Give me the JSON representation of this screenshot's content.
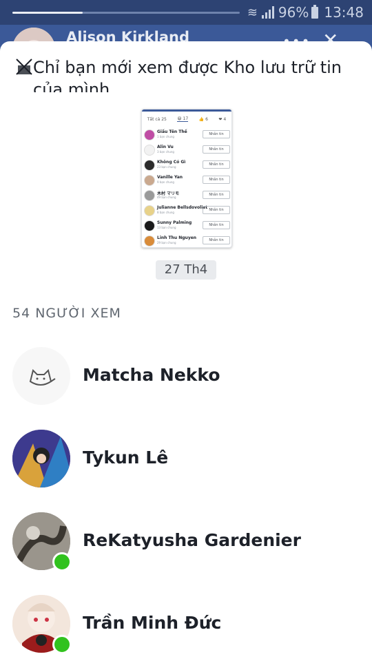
{
  "statusbar": {
    "battery": "96%",
    "time": "13:48",
    "progress": 0.31
  },
  "story_header": {
    "name": "Alison Kirkland",
    "more": "•••",
    "close": "✕"
  },
  "privacy_notice": "Chỉ bạn mới xem được Kho lưu trữ tin của mình",
  "thumbnail": {
    "tabs": [
      "Tất cả 25",
      "😆 17",
      "👍 6",
      "❤ 4"
    ],
    "rows": [
      {
        "name": "Giấu Tên Thế",
        "sub": "1 bạn chung",
        "button": "Nhắn tin",
        "color": "#c04da5"
      },
      {
        "name": "Alin Vu",
        "sub": "3 bạn chung",
        "button": "Nhắn tin",
        "color": "#f2f2f2"
      },
      {
        "name": "Không Có Gì",
        "sub": "23 bạn chung",
        "button": "Nhắn tin",
        "color": "#2b2b2b"
      },
      {
        "name": "Vanille Yan",
        "sub": "9 bạn chung",
        "button": "Nhắn tin",
        "color": "#caa98f"
      },
      {
        "name": "木村 マリモ",
        "sub": "49 bạn chung",
        "button": "Nhắn tin",
        "color": "#9a9a9a"
      },
      {
        "name": "Julianne Bellsdovoliet",
        "sub": "8 bạn chung",
        "button": "Nhắn tin",
        "color": "#e8d28a"
      },
      {
        "name": "Sunny Palming",
        "sub": "13 bạn chung",
        "button": "Nhắn tin",
        "color": "#1a1a1a"
      },
      {
        "name": "Linh Thu Nguyen",
        "sub": "29 bạn chung",
        "button": "Nhắn tin",
        "color": "#d98c3a"
      }
    ]
  },
  "date_label": "27 Th4",
  "viewers_count": "54 NGƯỜI XEM",
  "viewers": [
    {
      "name": "Matcha Nekko",
      "online": false,
      "color": "#f7f7f7"
    },
    {
      "name": "Tykun Lê",
      "online": false,
      "color": "#4b3a8c"
    },
    {
      "name": "ReKatyusha Gardenier",
      "online": true,
      "color": "#8a857c"
    },
    {
      "name": "Trần Minh Đức",
      "online": true,
      "color": "#f3e3d8"
    }
  ]
}
